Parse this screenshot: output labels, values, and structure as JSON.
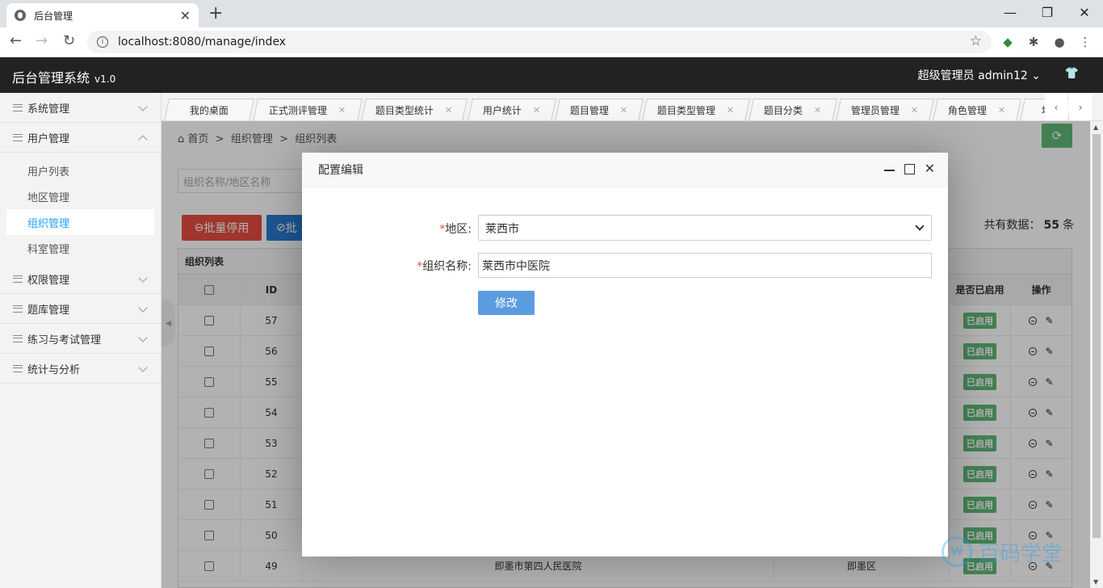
{
  "browser": {
    "tab_title": "后台管理",
    "url": "localhost:8080/manage/index"
  },
  "header": {
    "brand": "后台管理系统",
    "version": "v1.0",
    "user": "超级管理员  admin12"
  },
  "sidebar": {
    "items": [
      {
        "label": "系统管理"
      },
      {
        "label": "用户管理"
      },
      {
        "label": "权限管理"
      },
      {
        "label": "题库管理"
      },
      {
        "label": "练习与考试管理"
      },
      {
        "label": "统计与分析"
      }
    ],
    "sub_items": [
      {
        "label": "用户列表"
      },
      {
        "label": "地区管理"
      },
      {
        "label": "组织管理"
      },
      {
        "label": "科室管理"
      }
    ]
  },
  "tabs": [
    {
      "label": "我的桌面"
    },
    {
      "label": "正式测评管理"
    },
    {
      "label": "题目类型统计"
    },
    {
      "label": "用户统计"
    },
    {
      "label": "题目管理"
    },
    {
      "label": "题目类型管理"
    },
    {
      "label": "题目分类"
    },
    {
      "label": "管理员管理"
    },
    {
      "label": "角色管理"
    },
    {
      "label": "地"
    }
  ],
  "breadcrumb": {
    "home": "首页",
    "level1": "组织管理",
    "level2": "组织列表",
    "sep": ">"
  },
  "search": {
    "placeholder": "组织名称/地区名称"
  },
  "toolbar": {
    "disable_label": "批量停用",
    "enable_label": "批",
    "total_label": "共有数据：",
    "total_count": "55",
    "total_unit": "条"
  },
  "table": {
    "title": "组织列表",
    "headers": {
      "id": "ID",
      "enabled": "是否已启用",
      "actions": "操作"
    },
    "rows": [
      {
        "id": "57",
        "name": "",
        "region": "",
        "status": "已启用"
      },
      {
        "id": "56",
        "name": "",
        "region": "",
        "status": "已启用"
      },
      {
        "id": "55",
        "name": "",
        "region": "",
        "status": "已启用"
      },
      {
        "id": "54",
        "name": "",
        "region": "",
        "status": "已启用"
      },
      {
        "id": "53",
        "name": "",
        "region": "",
        "status": "已启用"
      },
      {
        "id": "52",
        "name": "",
        "region": "",
        "status": "已启用"
      },
      {
        "id": "51",
        "name": "",
        "region": "",
        "status": "已启用"
      },
      {
        "id": "50",
        "name": "",
        "region": "",
        "status": "已启用"
      },
      {
        "id": "49",
        "name": "即墨市第四人民医院",
        "region": "即墨区",
        "status": "已启用"
      }
    ]
  },
  "modal": {
    "title": "配置编辑",
    "region_label": "地区:",
    "region_value": "莱西市",
    "org_label": "组织名称:",
    "org_value": "莱西市中医院",
    "required_mark": "*",
    "submit_label": "修改"
  },
  "watermark": {
    "text": "百码学堂"
  }
}
